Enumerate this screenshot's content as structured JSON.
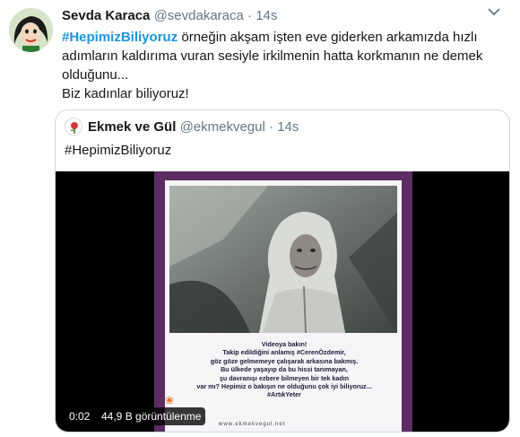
{
  "tweet": {
    "author_name": "Sevda Karaca",
    "author_handle": "@sevdakaraca",
    "separator": "·",
    "time": "14s",
    "hashtag": "#HepimizBiliyoruz",
    "text_after_hashtag": " örneğin akşam işten eve giderken arkamızda hızlı adımların kaldırıma vuran sesiyle irkilmenin hatta korkmanın ne demek olduğunu...",
    "text_line2": "Biz kadınlar biliyoruz!"
  },
  "quoted_tweet": {
    "author_name": "Ekmek ve Gül",
    "author_handle": "@ekmekvegul",
    "separator": "·",
    "time": "14s",
    "text": "#HepimizBiliyoruz",
    "video": {
      "elapsed": "0:02",
      "views": "44,9 B görüntülenme",
      "caption_lines": [
        "Videoya bakın!",
        "Takip edildiğini anlamış #CerenÖzdemir,",
        "göz göze gelmemeye çalışarak arkasına bakmış.",
        "Bu ülkede yaşayıp da bu hissi tanımayan,",
        "şu davranışı ezbere bilmeyen bir tek kadın",
        "var mı? Hepimiz o bakışın ne olduğunu çok iyi biliyoruz...",
        "#ArtıkYeter"
      ],
      "site": "www.ekmekvegul.net"
    }
  },
  "colors": {
    "hashtag": "#1b95e0",
    "secondary_text": "#657786",
    "border": "#ccd6dd",
    "video_frame": "#5b2d63"
  },
  "icons": {
    "more": "chevron-down-icon",
    "avatar": "cartoon-avatar",
    "quote_avatar": "rose-logo-icon"
  }
}
